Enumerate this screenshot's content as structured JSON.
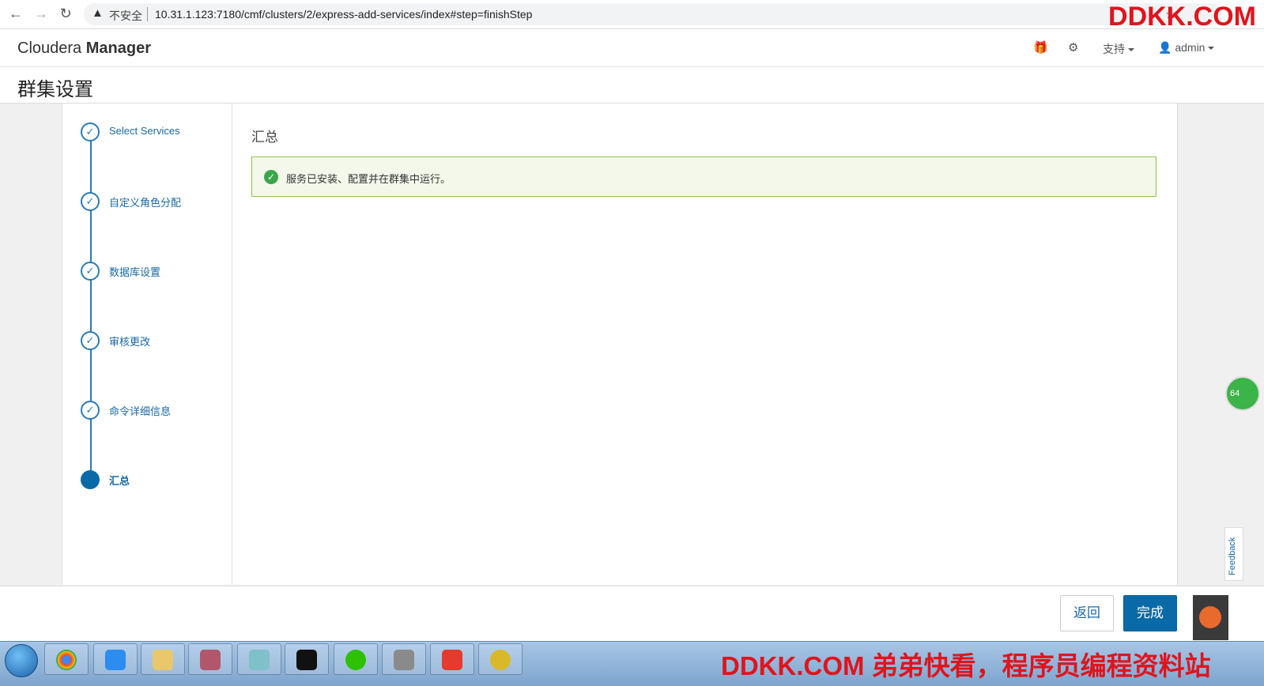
{
  "browser": {
    "insecure_label": "不安全",
    "url": "10.31.1.123:7180/cmf/clusters/2/express-add-services/index#step=finishStep"
  },
  "watermark_top": "DDKK.COM",
  "header": {
    "brand_light": "Cloudera",
    "brand_bold": "Manager",
    "support_menu": "支持",
    "user_menu": "admin"
  },
  "page_title": "群集设置",
  "steps": [
    {
      "label": "Select Services",
      "state": "done"
    },
    {
      "label": "自定义角色分配",
      "state": "done"
    },
    {
      "label": "数据库设置",
      "state": "done"
    },
    {
      "label": "审核更改",
      "state": "done"
    },
    {
      "label": "命令详细信息",
      "state": "done"
    },
    {
      "label": "汇总",
      "state": "active"
    }
  ],
  "content": {
    "section_title": "汇总",
    "success_message": "服务已安装、配置并在群集中运行。"
  },
  "footer": {
    "back_label": "返回",
    "finish_label": "完成"
  },
  "feedback_label": "Feedback",
  "bubble_value": "64",
  "watermark_bottom": "DDKK.COM 弟弟快看，程序员编程资料站",
  "colors": {
    "primary": "#0a6aa8",
    "step_blue": "#2b79b5",
    "success_border": "#8bc34a",
    "success_bg": "#f3f8ea",
    "watermark": "#e0141d"
  }
}
